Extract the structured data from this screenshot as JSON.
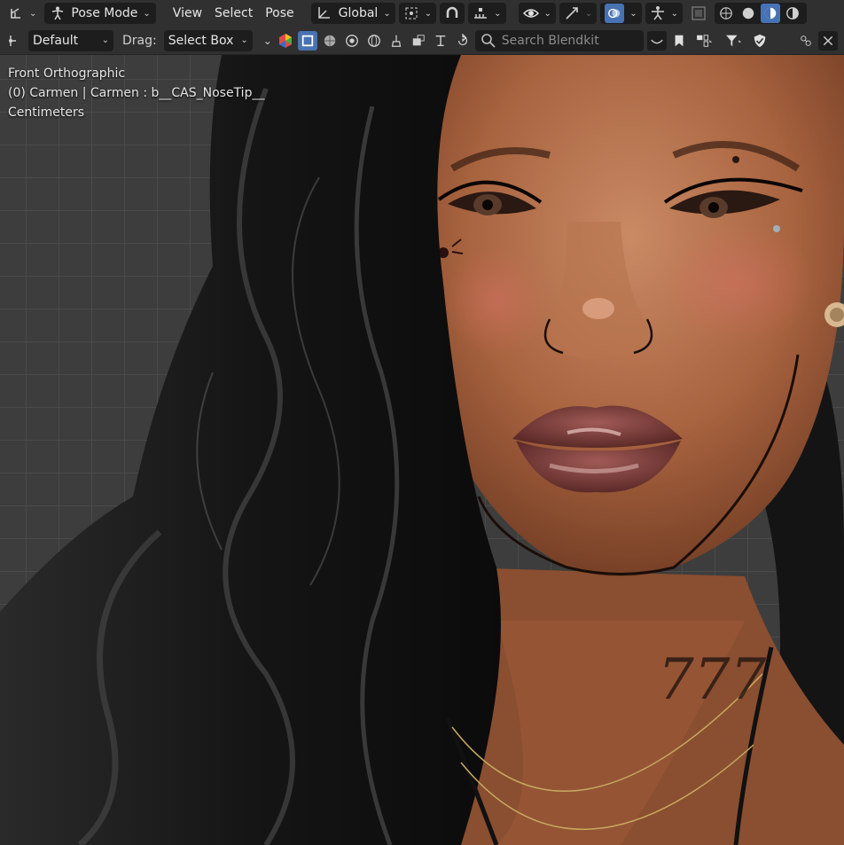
{
  "header": {
    "mode": "Pose Mode",
    "menus": [
      "View",
      "Select",
      "Pose"
    ],
    "transform_orientation": "Global"
  },
  "tool_header": {
    "preset": "Default",
    "drag_label": "Drag:",
    "drag_value": "Select Box",
    "search_placeholder": "Search Blendkit"
  },
  "viewport": {
    "view_name": "Front Orthographic",
    "object_info": "(0) Carmen | Carmen : b__CAS_NoseTip__",
    "units": "Centimeters",
    "neck_tattoo": "777"
  },
  "colors": {
    "accent": "#4772b3",
    "header_bg": "#303030",
    "viewport_bg": "#3d3d3d"
  }
}
